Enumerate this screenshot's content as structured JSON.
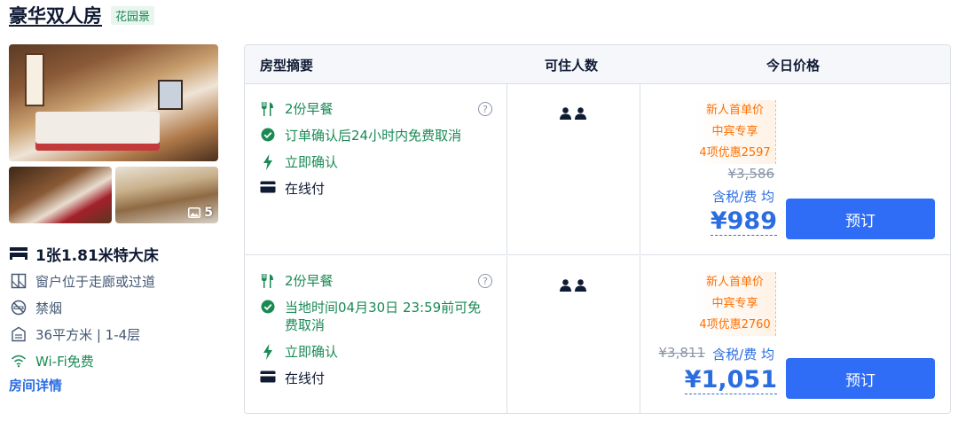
{
  "room": {
    "title": "豪华双人房",
    "view_tag": "花园景"
  },
  "photos": {
    "count": "5"
  },
  "features": {
    "bed": "1张1.81米特大床",
    "window": "窗户位于走廊或过道",
    "smoking": "禁烟",
    "area": "36平方米 | 1-4层",
    "wifi": "Wi-Fi免费"
  },
  "details_link": "房间详情",
  "table": {
    "headers": {
      "summary": "房型摘要",
      "occupancy": "可住人数",
      "price": "今日价格"
    },
    "rows": [
      {
        "breakfast": "2份早餐",
        "cancel": "订单确认后24小时内免费取消",
        "confirm": "立即确认",
        "payment": "在线付",
        "promo": [
          "新人首单价",
          "中宾专享",
          "4项优惠2597"
        ],
        "original_price": "¥3,586",
        "tax_note": "含税/费 均",
        "price": "¥989",
        "book_label": "预订"
      },
      {
        "breakfast": "2份早餐",
        "cancel": "当地时间04月30日 23:59前可免费取消",
        "confirm": "立即确认",
        "payment": "在线付",
        "promo": [
          "新人首单价",
          "中宾专享",
          "4项优惠2760"
        ],
        "original_price": "¥3,811",
        "tax_note": "含税/费 均",
        "price": "¥1,051",
        "book_label": "预订"
      }
    ]
  },
  "colors": {
    "accent_blue": "#2f6df6",
    "price_blue": "#2b6de1",
    "green": "#1a8a55",
    "promo_orange": "#ff6f00"
  }
}
